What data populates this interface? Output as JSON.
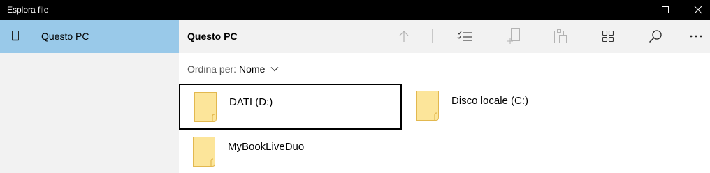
{
  "window": {
    "title": "Esplora file",
    "controls": {
      "minimize": "minimize",
      "maximize": "maximize",
      "close": "close"
    }
  },
  "sidebar": {
    "items": [
      {
        "label": "Questo PC",
        "icon": "device-icon",
        "selected": true
      }
    ]
  },
  "header": {
    "title": "Questo PC",
    "toolbar_icons": [
      "up-arrow-icon",
      "select-items-icon",
      "new-item-icon",
      "paste-icon",
      "view-grid-icon",
      "search-icon",
      "more-icon"
    ]
  },
  "sort": {
    "label": "Ordina per:",
    "value": "Nome"
  },
  "items": [
    {
      "label": "DATI (D:)",
      "icon": "folder-icon",
      "selected": true
    },
    {
      "label": "Disco locale (C:)",
      "icon": "folder-icon",
      "selected": false
    },
    {
      "label": "MyBookLiveDuo",
      "icon": "folder-icon",
      "selected": false
    }
  ],
  "colors": {
    "titlebar": "#000000",
    "sidebar_bg": "#f2f2f2",
    "nav_selected": "#99c9e9",
    "folder_fill": "#fce59a",
    "folder_stroke": "#e2b84f"
  }
}
